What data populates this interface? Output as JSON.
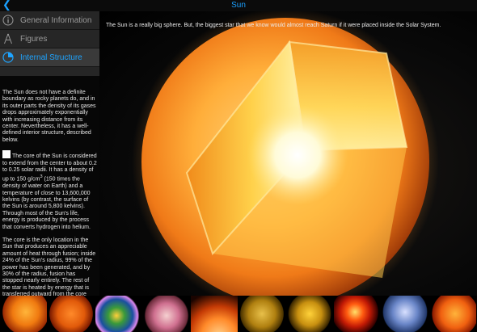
{
  "header": {
    "title": "Sun",
    "back_icon": "chevron-left-icon",
    "accent": "#1aa0ff"
  },
  "sidebar": {
    "items": [
      {
        "label": "General Information",
        "icon": "info-icon",
        "active": false
      },
      {
        "label": "Figures",
        "icon": "compass-icon",
        "active": false
      },
      {
        "label": "Internal Structure",
        "icon": "pie-chart-icon",
        "active": true
      }
    ],
    "paragraphs": {
      "intro": "The Sun does not have a definite boundary as rocky planets do, and in its outer parts the density of its gases drops approximately exponentially with increasing distance from its center. Nevertheless, it has a well-defined interior structure, described below.",
      "core_before_sup": "The core of the Sun is considered to extend from the center to about 0.2 to 0.25 solar radii. It has a density of up to 150 g/cm",
      "core_sup": "3",
      "core_after_sup": " (150 times the density of water on Earth) and a temperature of close to 13,600,000 kelvins (by contrast, the surface of the Sun is around 5,800 kelvins). Through most of the Sun's life, energy is produced by the process that converts hydrogen into helium.",
      "fusion": "The core is the only location in the Sun that produces an appreciable amount of heat through fusion; inside 24% of the Sun's radius, 99% of the power has been generated, and by 30% of the radius, fusion has stopped nearly entirely. The rest of the star is heated by energy that is transferred outward from the core and the layers just outside."
    }
  },
  "main": {
    "caption": "The Sun is a really big sphere. But, the biggest star that we know would almost reach Saturn if it were placed inside the Solar System."
  },
  "thumbnails": [
    "sun-image-1",
    "sun-image-2",
    "sun-image-3",
    "sun-image-4",
    "sun-image-5",
    "sun-image-6",
    "sun-image-7",
    "sun-image-8",
    "sun-image-9",
    "sun-image-10"
  ]
}
